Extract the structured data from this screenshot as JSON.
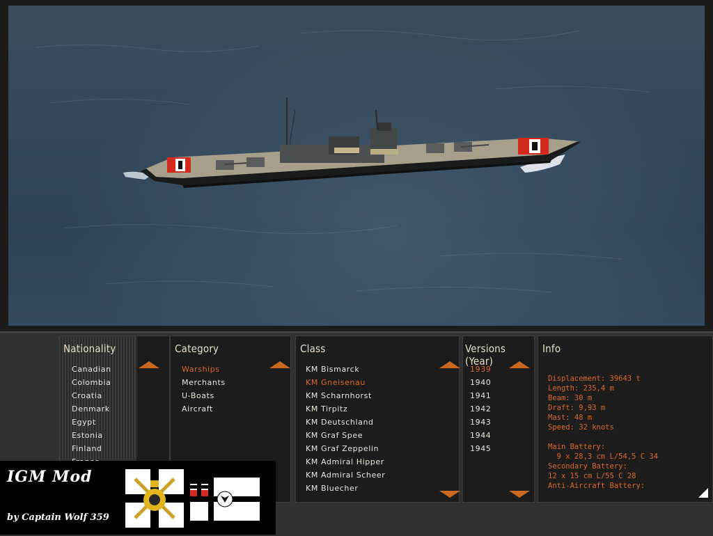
{
  "panels": {
    "nationality": {
      "title": "Nationality",
      "items": [
        "Canadian",
        "Colombia",
        "Croatia",
        "Denmark",
        "Egypt",
        "Estonia",
        "Finland",
        "France"
      ]
    },
    "category": {
      "title": "Category",
      "items": [
        "Warships",
        "Merchants",
        "U-Boats",
        "Aircraft"
      ],
      "selected_index": 0
    },
    "class": {
      "title": "Class",
      "items": [
        "KM  Bismarck",
        "KM  Gneisenau",
        "KM  Scharnhorst",
        "KM  Tirpitz",
        "KM  Deutschland",
        "KM  Graf Spee",
        "KM  Graf Zeppelin",
        "KM  Admiral Hipper",
        "KM  Admiral Scheer",
        "KM  Bluecher"
      ],
      "selected_index": 1
    },
    "versions": {
      "title": "Versions (Year)",
      "items": [
        "1939",
        "1940",
        "1941",
        "1942",
        "1943",
        "1944",
        "1945"
      ],
      "selected_index": 0
    },
    "info": {
      "title": "Info",
      "lines": [
        "Displacement: 39643 t",
        "Length: 235,4 m",
        "Beam: 30 m",
        "Draft: 9,93 m",
        "Mast: 48 m",
        "Speed: 32 knots",
        "",
        "Main Battery:",
        "  9 x 28,3 cm L/54,5 C 34",
        "Secondary Battery:",
        "12 x 15 cm L/55 C 28",
        "Anti-Aircraft Battery:"
      ]
    }
  },
  "badge": {
    "title": "IGM Mod",
    "author": "by Captain Wolf 359"
  },
  "colors": {
    "accent": "#d9692a",
    "text": "#ece6da",
    "panel_bg": "#1c1c1c",
    "arrow": "#c9691e"
  },
  "icons": {
    "scroll_up": "triangle-up-icon",
    "scroll_down": "triangle-down-icon",
    "resize": "resize-corner-icon"
  }
}
